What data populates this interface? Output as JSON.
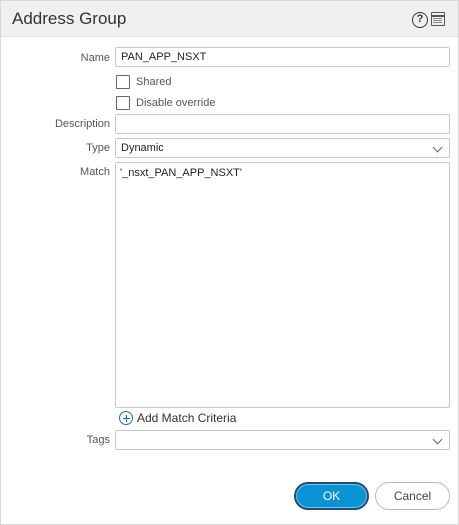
{
  "dialog": {
    "title": "Address Group"
  },
  "icons": {
    "help": "help-icon",
    "window": "window-icon"
  },
  "form": {
    "name_label": "Name",
    "name_value": "PAN_APP_NSXT",
    "shared_label": "Shared",
    "shared_checked": false,
    "disable_override_label": "Disable override",
    "disable_override_checked": false,
    "description_label": "Description",
    "description_value": "",
    "type_label": "Type",
    "type_value": "Dynamic",
    "match_label": "Match",
    "match_value": "'_nsxt_PAN_APP_NSXT'",
    "add_match_criteria_label": "Add Match Criteria",
    "tags_label": "Tags",
    "tags_value": ""
  },
  "buttons": {
    "ok_label": "OK",
    "cancel_label": "Cancel"
  },
  "colors": {
    "primary_button": "#0a93d3",
    "primary_button_border": "#1a4e7a",
    "link_icon": "#1a6ea8"
  }
}
